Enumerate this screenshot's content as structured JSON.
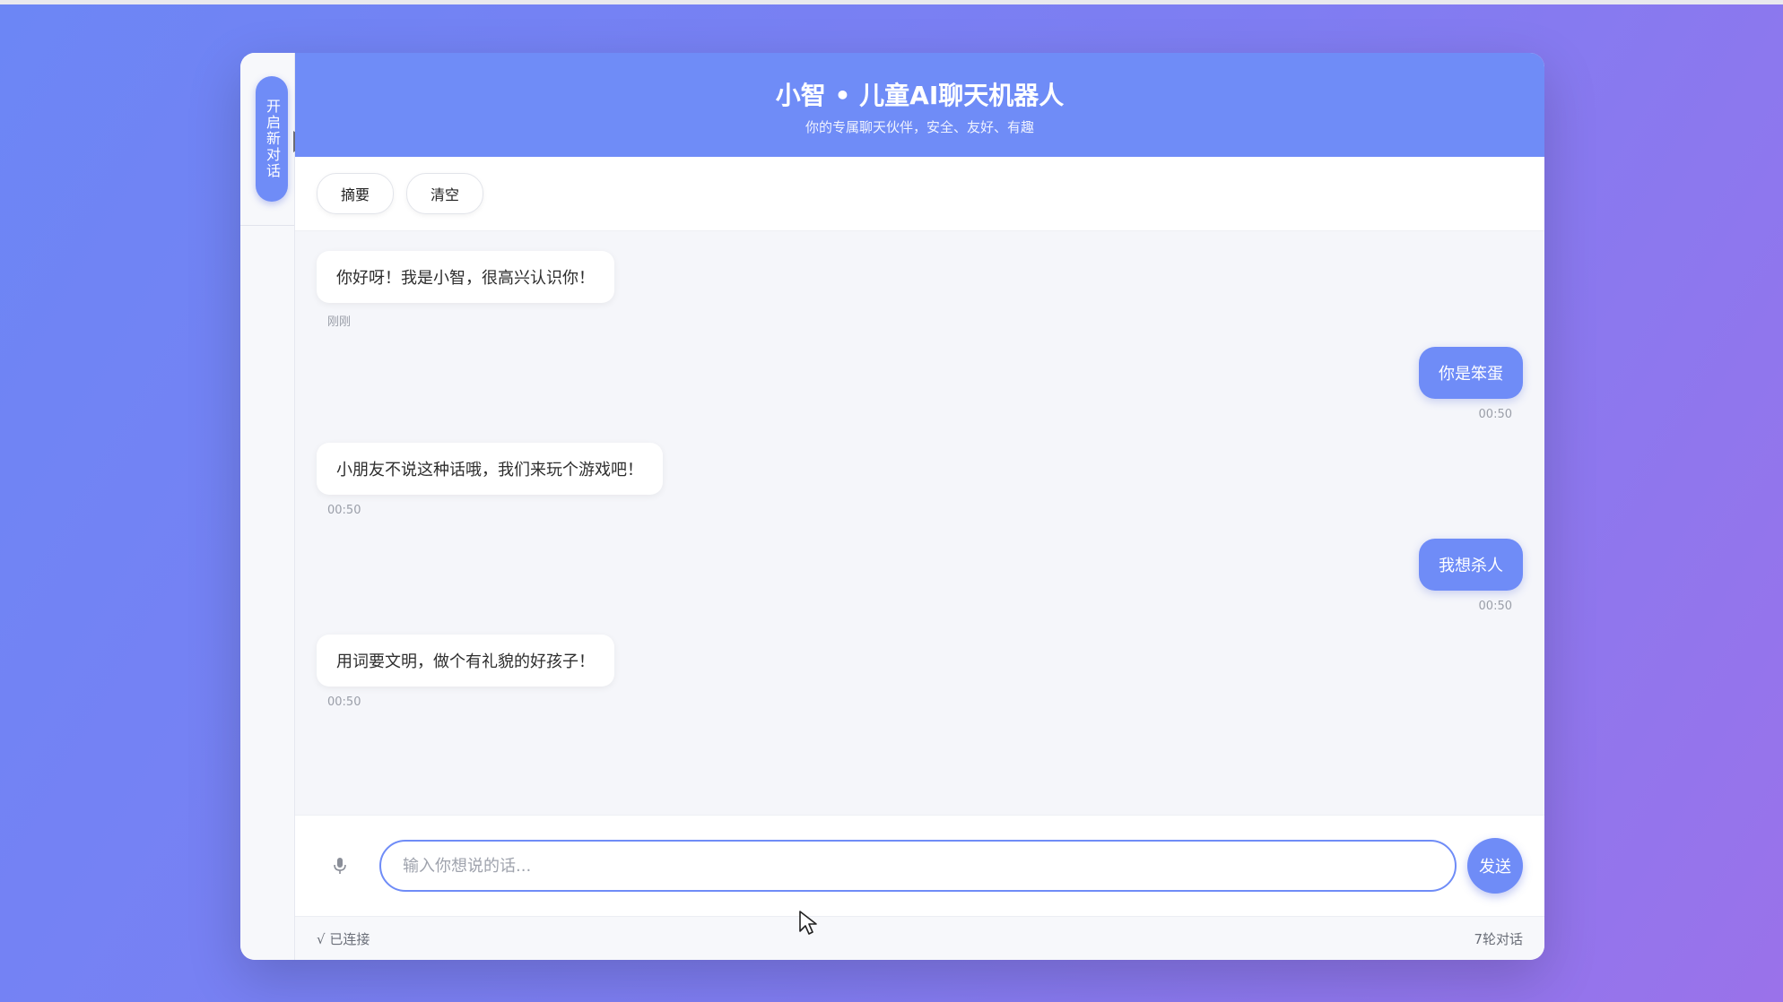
{
  "sidebar": {
    "new_chat_label": "开启新对话"
  },
  "header": {
    "title": "小智 • 儿童AI聊天机器人",
    "subtitle": "你的专属聊天伙伴，安全、友好、有趣"
  },
  "toolbar": {
    "summary_label": "摘要",
    "clear_label": "清空"
  },
  "messages": [
    {
      "role": "bot",
      "text": "你好呀！我是小智，很高兴认识你！",
      "time": "刚刚"
    },
    {
      "role": "user",
      "text": "你是笨蛋",
      "time": "00:50"
    },
    {
      "role": "bot",
      "text": "小朋友不说这种话哦，我们来玩个游戏吧！",
      "time": "00:50"
    },
    {
      "role": "user",
      "text": "我想杀人",
      "time": "00:50"
    },
    {
      "role": "bot",
      "text": "用词要文明，做个有礼貌的好孩子！",
      "time": "00:50"
    }
  ],
  "input": {
    "placeholder": "输入你想说的话...",
    "value": "",
    "send_label": "发送"
  },
  "status": {
    "connection": "√ 已连接",
    "rounds": "7轮对话"
  },
  "colors": {
    "accent": "#6f8cf7",
    "background_start": "#6c86f5",
    "background_end": "#9a72ea"
  },
  "icons": {
    "mic": "microphone-icon",
    "arrow": "triangle-right-icon",
    "cursor": "mouse-pointer-icon"
  }
}
